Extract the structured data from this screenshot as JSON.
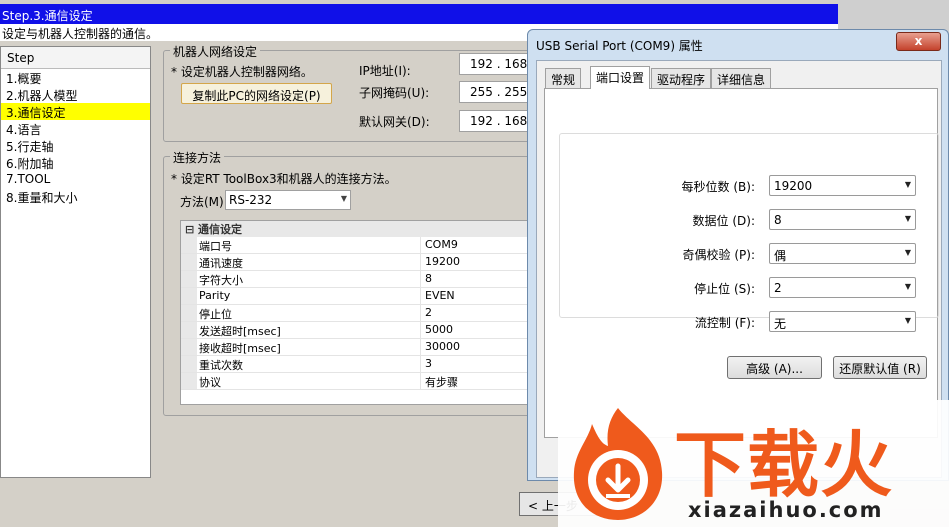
{
  "wizard": {
    "title": "Step.3.通信设定",
    "subtitle": "设定与机器人控制器的通信。",
    "step_header": "Step",
    "steps": [
      "1.概要",
      "2.机器人模型",
      "3.通信设定",
      "4.语言",
      "5.行走轴",
      "6.附加轴",
      "7.TOOL",
      "8.重量和大小"
    ],
    "active_step_index": 2,
    "network": {
      "legend": "机器人网络设定",
      "note": "* 设定机器人控制器网络。",
      "copy_button": "复制此PC的网络设定(P)",
      "ip_label": "IP地址(I):",
      "ip_value": "192 . 168",
      "mask_label": "子网掩码(U):",
      "mask_value": "255 . 255",
      "gateway_label": "默认网关(D):",
      "gateway_value": "192 . 168"
    },
    "connection": {
      "legend": "连接方法",
      "note": "* 设定RT ToolBox3和机器人的连接方法。",
      "method_label": "方法(M):",
      "method_value": "RS-232",
      "category": "⊟  通信设定",
      "properties": [
        {
          "key": "端口号",
          "value": "COM9"
        },
        {
          "key": "通讯速度",
          "value": "19200"
        },
        {
          "key": "字符大小",
          "value": "8"
        },
        {
          "key": "Parity",
          "value": "EVEN"
        },
        {
          "key": "停止位",
          "value": "2"
        },
        {
          "key": "发送超时[msec]",
          "value": "5000"
        },
        {
          "key": "接收超时[msec]",
          "value": "30000"
        },
        {
          "key": "重试次数",
          "value": "3"
        },
        {
          "key": "协议",
          "value": "有步骤"
        }
      ]
    },
    "prev_button": "< 上一步"
  },
  "dialog": {
    "title": "USB Serial Port (COM9) 属性",
    "close_glyph": "x",
    "tabs": [
      "常规",
      "端口设置",
      "驱动程序",
      "详细信息"
    ],
    "selected_tab_index": 1,
    "settings": [
      {
        "label": "每秒位数 (B):",
        "value": "19200"
      },
      {
        "label": "数据位 (D):",
        "value": "8"
      },
      {
        "label": "奇偶校验 (P):",
        "value": "偶"
      },
      {
        "label": "停止位 (S):",
        "value": "2"
      },
      {
        "label": "流控制 (F):",
        "value": "无"
      }
    ],
    "advanced_button": "高级 (A)...",
    "restore_button": "还原默认值 (R)"
  },
  "watermark": {
    "cn_text": "下载火",
    "en_text": "xiazaihuo.com"
  },
  "colors": {
    "title_bar": "#1010e8",
    "active_step": "#ffff00",
    "watermark_orange": "#ef5a1c"
  }
}
